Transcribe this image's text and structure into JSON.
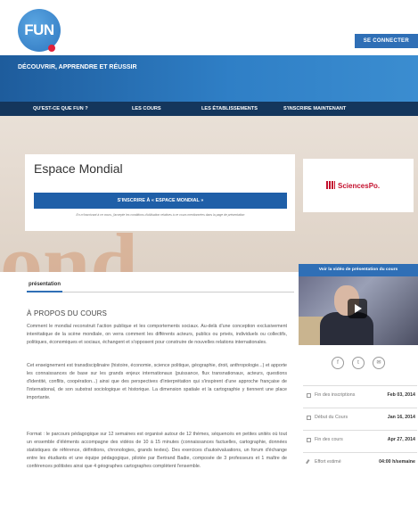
{
  "header": {
    "logo_text": "FUN",
    "connect_label": "SE CONNECTER"
  },
  "band": {
    "tagline": "DÉCOUVRIR, APPRENDRE ET RÉUSSIR"
  },
  "nav": {
    "items": [
      {
        "label": "QU'EST-CE QUE FUN ?"
      },
      {
        "label": "LES COURS"
      },
      {
        "label": "LES ÉTABLISSEMENTS"
      },
      {
        "label": "S'INSCRIRE MAINTENANT"
      }
    ]
  },
  "hero": {
    "ghost_text": "ond",
    "course_title": "Espace Mondial",
    "enroll_label": "S'INSCRIRE À « ESPACE MONDIAL »",
    "legal_text": "En m'inscrivant à ce cours, j'accepte les conditions d'utilisation relatives à ce cours mentionnées dans la page de présentation",
    "partner_name": "SciencesPo."
  },
  "content": {
    "tab_label": "présentation",
    "heading": "À PROPOS DU COURS",
    "paragraphs": [
      "Comment le mondial reconstruit l'action publique et les comportements sociaux. Au-delà d'une conception exclusivement interétatique de la scène mondiale, on verra comment les différents acteurs, publics ou privés, individuels ou collectifs, politiques, économiques et sociaux, échangent et s'opposent pour construire de nouvelles relations internationales.",
      "Cet enseignement est transdisciplinaire (histoire, économie, science politique, géographie, droit, anthropologie...) et apporte les connaissances de base sur les grands enjeux internationaux (puissance, flux transnationaux, acteurs, questions d'identité, conflits, coopération...) ainsi que des perspectives d'interprétation qui s'inspirent d'une approche française de l'international, de son substrat sociologique et historique. La dimension spatiale et la cartographie y tiennent une place importante.",
      "Format : le parcours pédagogique sur 12 semaines est organisé autour de 12 thèmes, séquencés en petites unités où tout un ensemble d'éléments accompagne des vidéos de 10 à 15 minutes (connaissances factuelles, cartographie, données statistiques de référence, définitions, chronologies, grands textes). Des exercices d'autoévaluations, un forum d'échange entre les étudiants et une équipe pédagogique, pilotée par Bertrand Badie, composée de 3 professeurs et 1 maître de conférences politistes ainsi que 4 géographes cartographes complètent l'ensemble."
    ]
  },
  "sidebar": {
    "video_label": "Voir la vidéo de présentation du cours",
    "info": [
      {
        "label": "Fin des inscriptions",
        "value": "Feb 03, 2014"
      },
      {
        "label": "Début du Cours",
        "value": "Jan 16, 2014"
      },
      {
        "label": "Fin des cours",
        "value": "Apr 27, 2014"
      },
      {
        "label": "Effort estimé",
        "value": "04:00 h/semaine"
      }
    ]
  }
}
